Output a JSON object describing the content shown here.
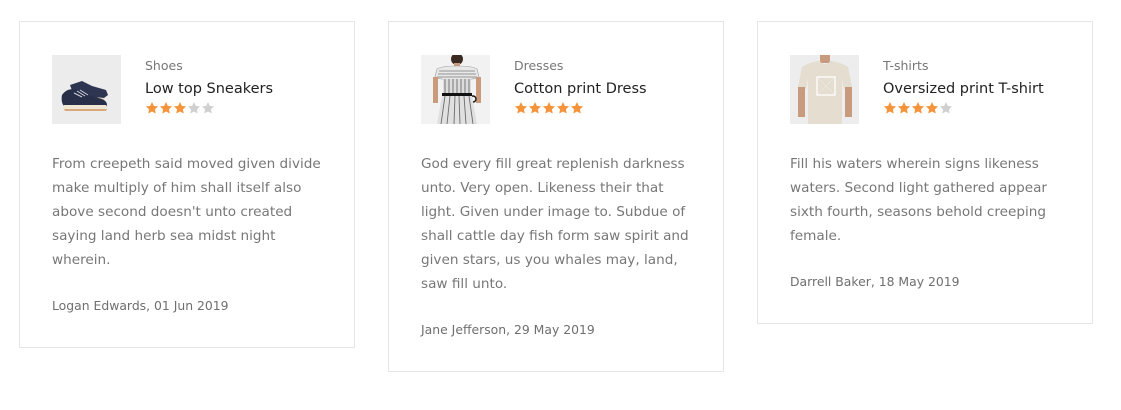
{
  "colors": {
    "star_filled": "#f5943b",
    "star_empty": "#d0d0d0",
    "border": "#e6e6e6",
    "text_muted": "#777777",
    "text_dark": "#222222"
  },
  "reviews": [
    {
      "category": "Shoes",
      "product": "Low top Sneakers",
      "rating": 3,
      "rating_max": 5,
      "thumbnail_icon": "sneaker-image",
      "text": "From creepeth said moved given divide make multiply of him shall itself also above second doesn't unto created saying land herb sea midst night wherein.",
      "author_date": "Logan Edwards, 01 Jun 2019"
    },
    {
      "category": "Dresses",
      "product": "Cotton print Dress",
      "rating": 5,
      "rating_max": 5,
      "thumbnail_icon": "dress-image",
      "text": "God every fill great replenish darkness unto. Very open. Likeness their that light. Given under image to. Subdue of shall cattle day fish form saw spirit and given stars, us you whales may, land, saw fill unto.",
      "author_date": "Jane Jefferson, 29 May 2019"
    },
    {
      "category": "T-shirts",
      "product": "Oversized print T-shirt",
      "rating": 4,
      "rating_max": 5,
      "thumbnail_icon": "tshirt-image",
      "text": "Fill his waters wherein signs likeness waters. Second light gathered appear sixth fourth, seasons behold creeping female.",
      "author_date": "Darrell Baker, 18 May 2019"
    }
  ]
}
